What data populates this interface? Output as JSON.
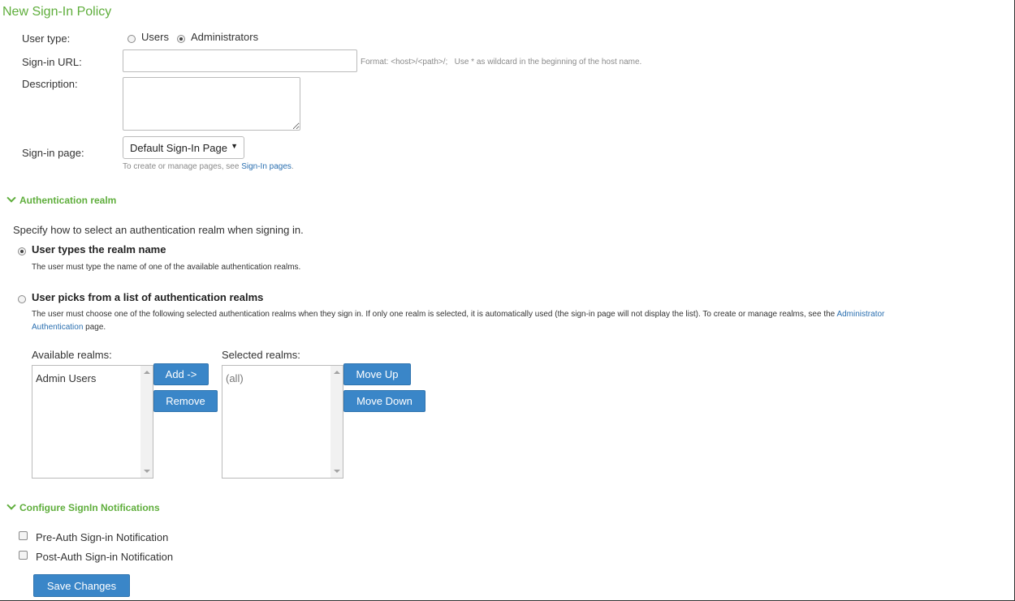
{
  "page": {
    "title": "New Sign-In Policy"
  },
  "user_type": {
    "label": "User type:",
    "options": [
      {
        "label": "Users",
        "selected": false
      },
      {
        "label": "Administrators",
        "selected": true
      }
    ]
  },
  "signin_url": {
    "label": "Sign-in URL:",
    "value": "",
    "hint": "Format: <host>/<path>/;   Use * as wildcard in the beginning of the host name."
  },
  "description": {
    "label": "Description:",
    "value": ""
  },
  "signin_page": {
    "label": "Sign-in page:",
    "selected": "Default Sign-In Page",
    "hint_prefix": "To create or manage pages, see ",
    "hint_link": "Sign-In pages",
    "hint_suffix": "."
  },
  "auth_realm": {
    "heading": "Authentication realm",
    "intro": "Specify how to select an authentication realm when signing in.",
    "option1": {
      "label": "User types the realm name",
      "desc": "The user must type the name of one of the available authentication realms.",
      "selected": true
    },
    "option2": {
      "label": "User picks from a list of authentication realms",
      "desc_prefix": "The user must choose one of the following selected authentication realms when they sign in. If only one realm is selected, it is automatically used (the sign-in page will not display the list). To create or manage realms, see the ",
      "desc_link_line1": "Administrator",
      "desc_link_line2": "Authentication",
      "desc_suffix": " page.",
      "selected": false
    },
    "available_label": "Available realms:",
    "available_items": [
      "Admin Users"
    ],
    "add_button": "Add ->",
    "remove_button": "Remove",
    "selected_label": "Selected realms:",
    "selected_items": [
      "(all)"
    ],
    "move_up_button": "Move Up",
    "move_down_button": "Move Down"
  },
  "notifications": {
    "heading": "Configure SignIn Notifications",
    "pre_auth": {
      "label": "Pre-Auth Sign-in Notification",
      "checked": false
    },
    "post_auth": {
      "label": "Post-Auth Sign-in Notification",
      "checked": false
    }
  },
  "save_button": "Save Changes",
  "colors": {
    "accent_green": "#5fae3c",
    "button_blue": "#3a86c8",
    "link_blue": "#2a6fb0"
  }
}
